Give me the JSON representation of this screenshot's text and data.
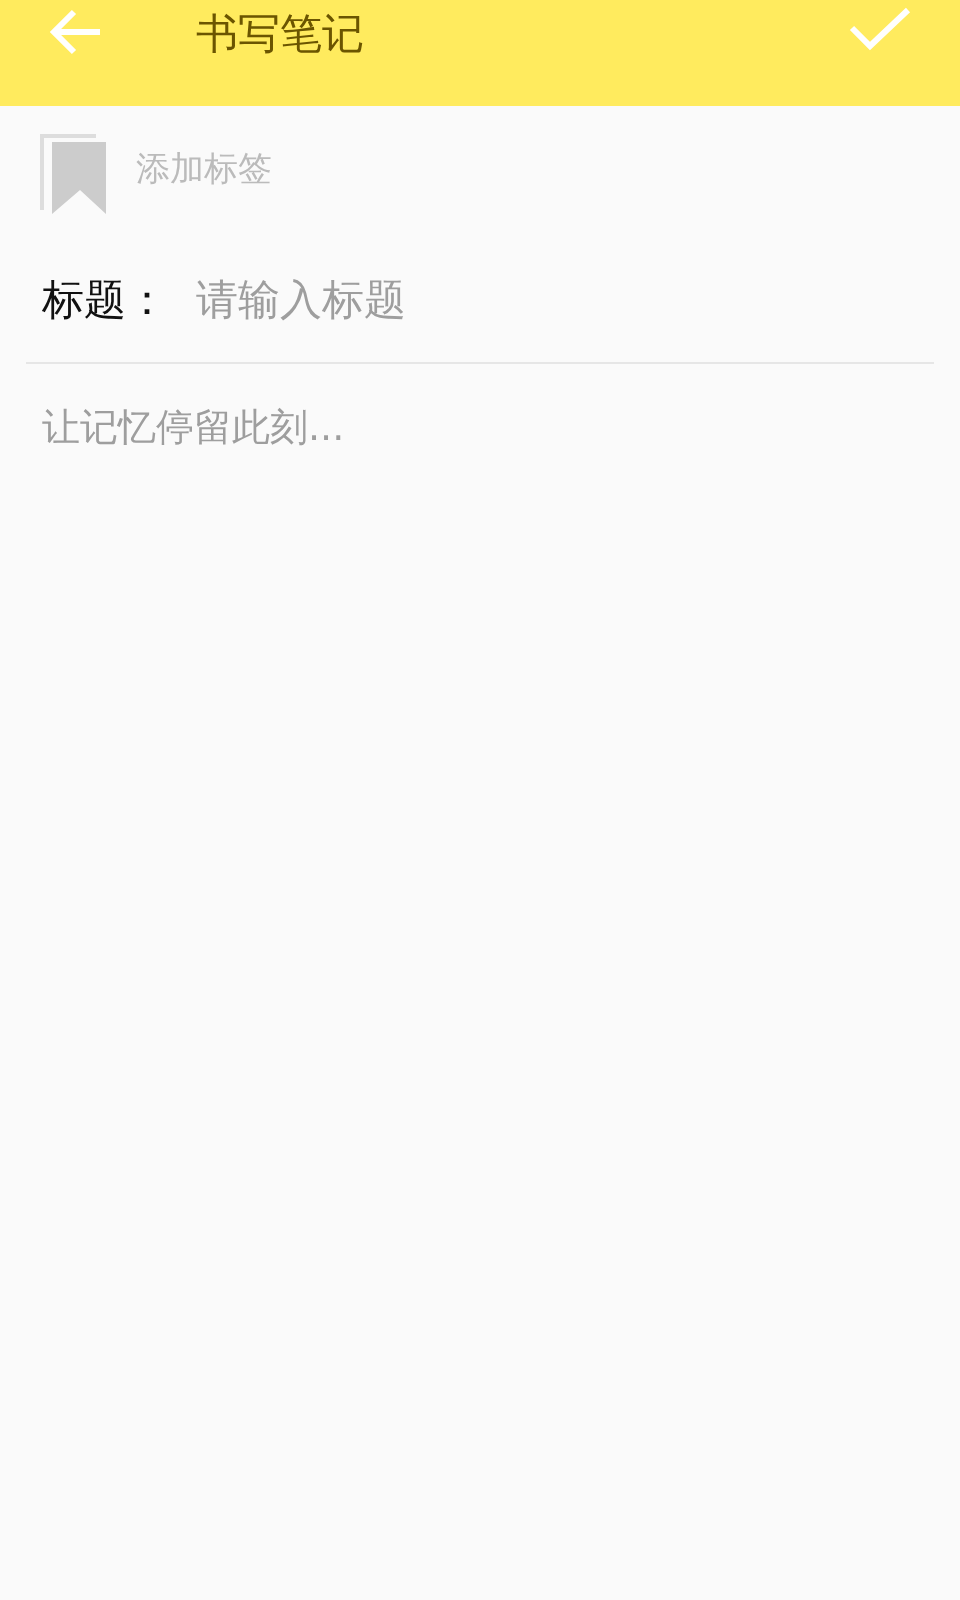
{
  "toolbar": {
    "title": "书写笔记"
  },
  "tag": {
    "label": "添加标签"
  },
  "title_field": {
    "label": "标题：",
    "placeholder": "请输入标题"
  },
  "body_field": {
    "placeholder": "让记忆停留此刻..."
  }
}
